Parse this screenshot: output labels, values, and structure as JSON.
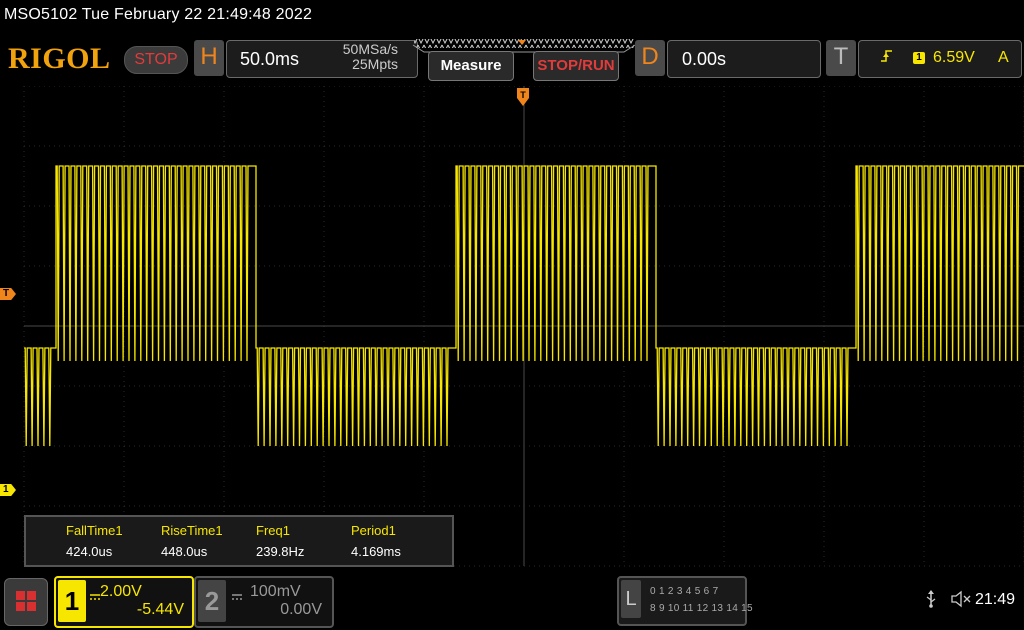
{
  "status_line": "MSO5102  Tue February 22 21:49:48 2022",
  "logo": "RIGOL",
  "run_state": "STOP",
  "horizontal": {
    "letter": "H",
    "timebase": "50.0ms",
    "sample_rate": "50MSa/s",
    "memory_depth": "25Mpts"
  },
  "buttons": {
    "measure": "Measure",
    "stop_run": "STOP/RUN"
  },
  "delay": {
    "letter": "D",
    "value": "0.00s"
  },
  "trigger": {
    "letter": "T",
    "edge_icon": "rising-edge-icon",
    "source": "1",
    "level": "6.59V",
    "mode": "A"
  },
  "waveform_markers": {
    "trigger_top": "T",
    "trigger_level": "T",
    "channel1": "1"
  },
  "measurements": [
    {
      "label": "FallTime1",
      "value": "424.0us"
    },
    {
      "label": "RiseTime1",
      "value": "448.0us"
    },
    {
      "label": "Freq1",
      "value": "239.8Hz"
    },
    {
      "label": "Period1",
      "value": "4.169ms"
    }
  ],
  "channel1": {
    "number": "1",
    "scale": "2.00V",
    "offset": "-5.44V",
    "color": "#f7e600"
  },
  "channel2": {
    "number": "2",
    "scale": "100mV",
    "offset": "0.00V"
  },
  "logic_analyzer": {
    "letter": "L",
    "row1": "0 1 2 3  4 5 6 7",
    "row2": "8 9 10 11 12 13 14 15"
  },
  "clock": "21:49",
  "icons": {
    "usb": "usb-icon",
    "mute": "speaker-mute-icon",
    "menu": "menu-grid-icon"
  }
}
